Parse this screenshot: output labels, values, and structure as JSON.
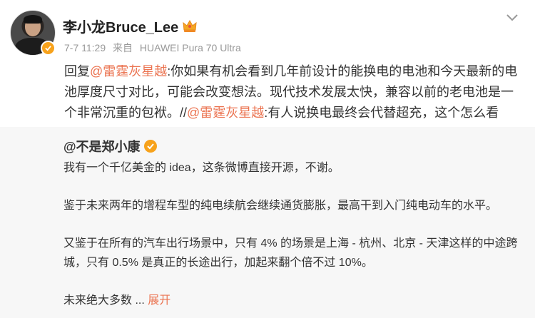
{
  "author": {
    "name": "李小龙Bruce_Lee",
    "time": "7-7 11:29",
    "source_prefix": "来自",
    "source_device": "HUAWEI Pura 70 Ultra"
  },
  "post": {
    "reply_prefix": "回复",
    "mention1": "@雷霆灰星越",
    "text1": ":你如果有机会看到几年前设计的能换电的电池和今天最新的电池厚度尺寸对比，可能会改变想法。现代技术发展太快，兼容以前的老电池是一个非常沉重的包袱。//",
    "mention2": "@雷霆灰星越",
    "text2": ":有人说换电最终会代替超充，这个怎么看"
  },
  "repost": {
    "user": "@不是郑小康",
    "para1": "我有一个千亿美金的 idea，这条微博直接开源，不谢。",
    "para2": "鉴于未来两年的增程车型的纯电续航会继续通货膨胀，最高干到入门纯电动车的水平。",
    "para3": "又鉴于在所有的汽车出行场景中，只有 4% 的场景是上海 - 杭州、北京 - 天津这样的中途跨城，只有 0.5% 是真正的长途出行，加起来翻个倍不过 10%。",
    "para4": "未来绝大多数",
    "ellipsis": " ...",
    "expand": "展开"
  },
  "colors": {
    "accent": "#eb7350",
    "verified": "#f7a21b",
    "repost_bg": "#f7f7f7"
  },
  "icons": [
    "crown-icon",
    "verified-badge-icon",
    "dropdown-chevron-icon",
    "orange-v-icon"
  ]
}
